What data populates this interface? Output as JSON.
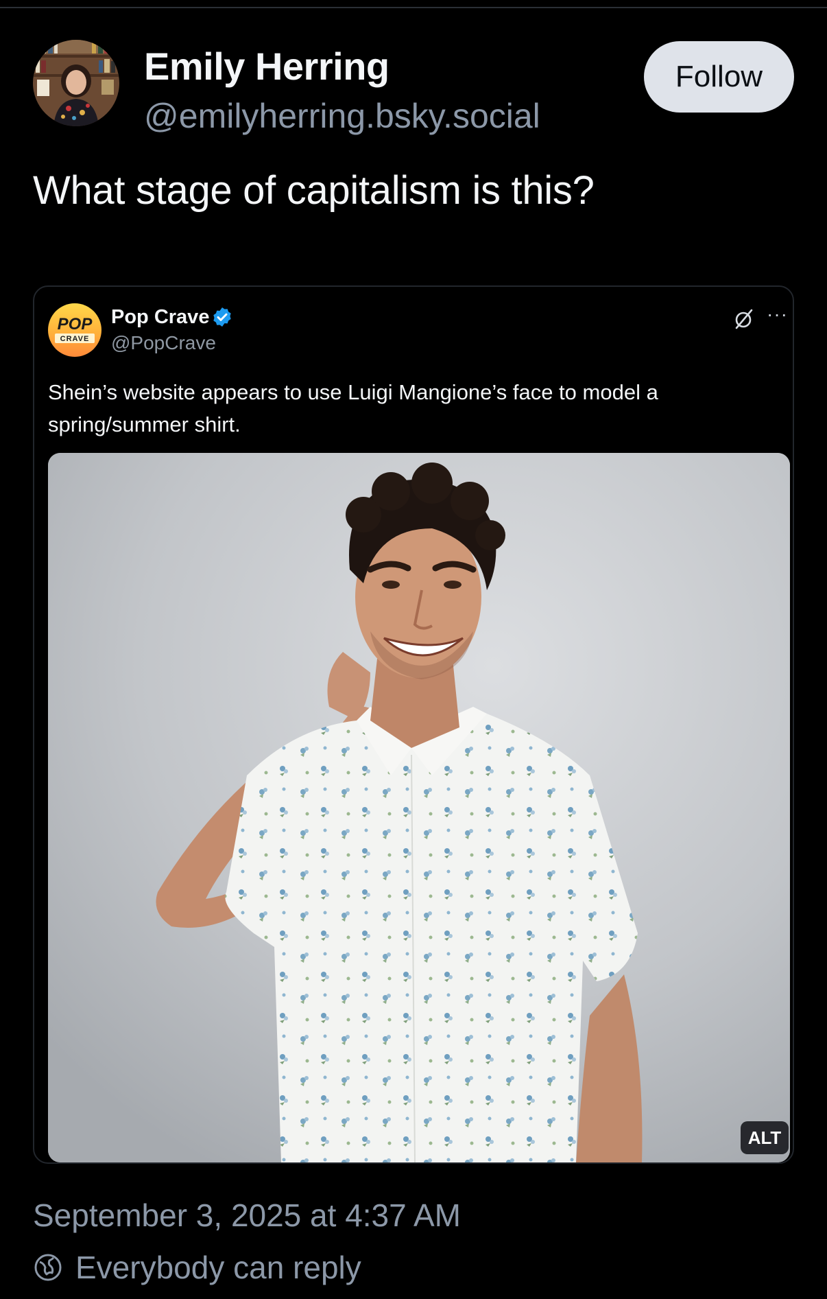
{
  "post": {
    "author_name": "Emily Herring",
    "author_handle": "@emilyherring.bsky.social",
    "follow_label": "Follow",
    "text": "What stage of capitalism is this?",
    "timestamp": "September 3, 2025 at 4:37 AM",
    "reply_setting": "Everybody can reply"
  },
  "quoted": {
    "logo_top": "POP",
    "logo_bottom": "CRAVE",
    "name": "Pop Crave",
    "handle": "@PopCrave",
    "verified": true,
    "text": "Shein’s website appears to use Luigi Mangione’s face to model a spring/summer shirt.",
    "image_alt_badge": "ALT",
    "icons": [
      "grok-icon",
      "more-icon"
    ]
  },
  "colors": {
    "background": "#000000",
    "muted_text": "#8c98a8",
    "follow_button": "#dfe3ea",
    "verified_blue": "#1d9bf0"
  }
}
